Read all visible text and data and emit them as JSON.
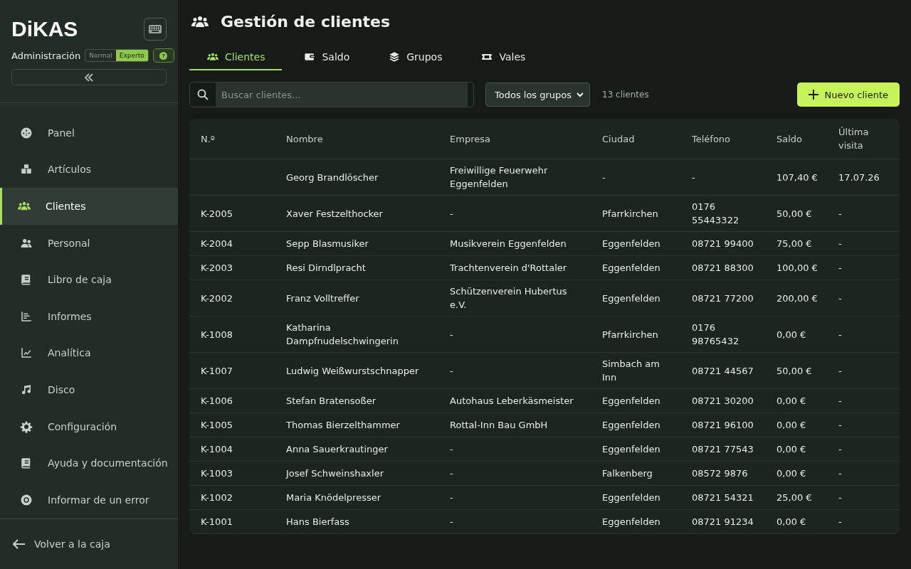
{
  "brand": {
    "logo": "DiKAS",
    "role": "Administración",
    "modes": [
      {
        "label": "Normal",
        "selected": false
      },
      {
        "label": "Experto",
        "selected": true
      }
    ],
    "help": "?"
  },
  "nav": [
    {
      "label": "Panel",
      "selected": false
    },
    {
      "label": "Artículos",
      "selected": false
    },
    {
      "label": "Clientes",
      "selected": true
    },
    {
      "label": "Personal",
      "selected": false
    },
    {
      "label": "Libro de caja",
      "selected": false
    },
    {
      "label": "Informes",
      "selected": false
    },
    {
      "label": "Analítica",
      "selected": false
    },
    {
      "label": "Disco",
      "selected": false
    },
    {
      "label": "Configuración",
      "selected": false
    },
    {
      "label": "Ayuda y documentación",
      "selected": false
    },
    {
      "label": "Informar de un error",
      "selected": false
    }
  ],
  "back": "Volver a la caja",
  "title": "Gestión de clientes",
  "tabs": [
    {
      "label": "Clientes",
      "selected": true
    },
    {
      "label": "Saldo",
      "selected": false
    },
    {
      "label": "Grupos",
      "selected": false
    },
    {
      "label": "Vales",
      "selected": false
    }
  ],
  "search": {
    "placeholder": "Buscar clientes..."
  },
  "group_filter": "Todos los grupos",
  "count": "13 clientes",
  "new_button": "Nuevo cliente",
  "table": {
    "columns": [
      "N.º",
      "Nombre",
      "Empresa",
      "Ciudad",
      "Teléfono",
      "Saldo",
      "Última visita"
    ],
    "rows": [
      [
        "",
        "Georg Brandlöscher",
        "Freiwillige Feuerwehr Eggenfelden",
        "-",
        "-",
        "107,40 €",
        "17.07.26"
      ],
      [
        "K-2005",
        "Xaver Festzelthocker",
        "-",
        "Pfarrkirchen",
        "0176 55443322",
        "50,00 €",
        "-"
      ],
      [
        "K-2004",
        "Sepp Blasmusiker",
        "Musikverein Eggenfelden",
        "Eggenfelden",
        "08721 99400",
        "75,00 €",
        "-"
      ],
      [
        "K-2003",
        "Resi Dirndlpracht",
        "Trachtenverein d'Rottaler",
        "Eggenfelden",
        "08721 88300",
        "100,00 €",
        "-"
      ],
      [
        "K-2002",
        "Franz Volltreffer",
        "Schützenverein Hubertus e.V.",
        "Eggenfelden",
        "08721 77200",
        "200,00 €",
        "-"
      ],
      [
        "K-1008",
        "Katharina Dampfnudelschwingerin",
        "-",
        "Pfarrkirchen",
        "0176 98765432",
        "0,00 €",
        "-"
      ],
      [
        "K-1007",
        "Ludwig Weißwurstschnapper",
        "-",
        "Simbach am Inn",
        "08721 44567",
        "50,00 €",
        "-"
      ],
      [
        "K-1006",
        "Stefan Bratensoßer",
        "Autohaus Leberkäsmeister",
        "Eggenfelden",
        "08721 30200",
        "0,00 €",
        "-"
      ],
      [
        "K-1005",
        "Thomas Bierzelthammer",
        "Rottal-Inn Bau GmbH",
        "Eggenfelden",
        "08721 96100",
        "0,00 €",
        "-"
      ],
      [
        "K-1004",
        "Anna Sauerkrautinger",
        "-",
        "Eggenfelden",
        "08721 77543",
        "0,00 €",
        "-"
      ],
      [
        "K-1003",
        "Josef Schweinshaxler",
        "-",
        "Falkenberg",
        "08572 9876",
        "0,00 €",
        "-"
      ],
      [
        "K-1002",
        "Maria Knödelpresser",
        "-",
        "Eggenfelden",
        "08721 54321",
        "25,00 €",
        "-"
      ],
      [
        "K-1001",
        "Hans Bierfass",
        "-",
        "Eggenfelden",
        "08721 91234",
        "0,00 €",
        "-"
      ]
    ]
  }
}
